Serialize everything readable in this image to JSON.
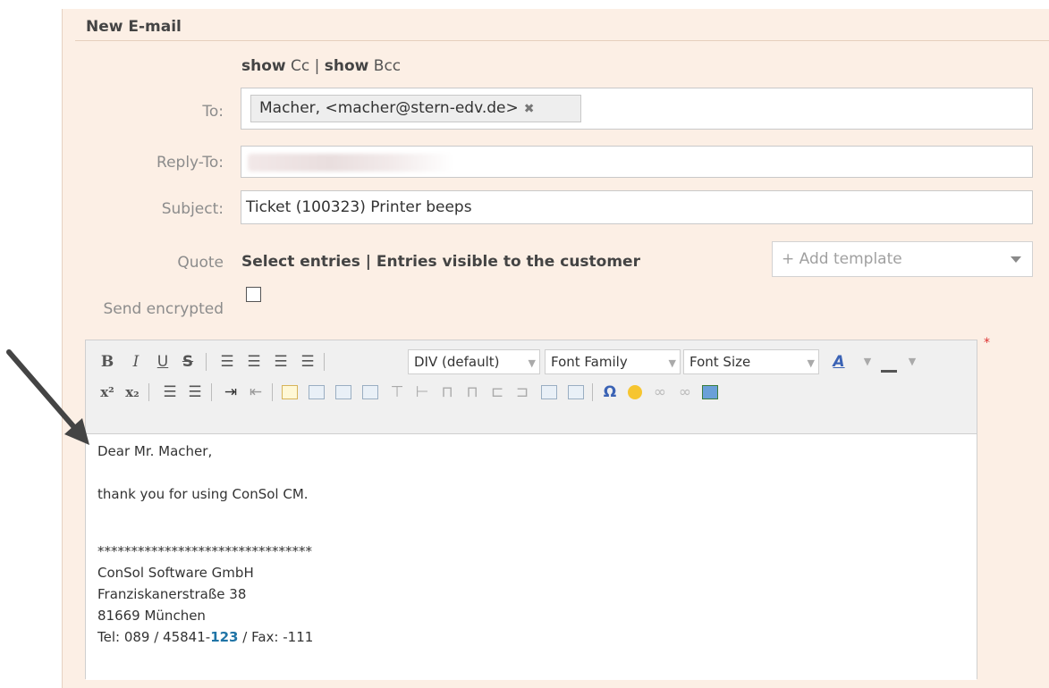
{
  "header": {
    "title": "New E-mail"
  },
  "cc_bcc": {
    "show1": "show",
    "cc": "Cc",
    "divider": "|",
    "show2": "show",
    "bcc": "Bcc"
  },
  "labels": {
    "to": "To:",
    "reply_to": "Reply-To:",
    "subject": "Subject:",
    "quote": "Quote",
    "send_encrypted": "Send encrypted"
  },
  "to": {
    "recipient_chip": "Macher, <macher@stern-edv.de>",
    "remove_icon": "✖"
  },
  "subject": {
    "value": "Ticket (100323) Printer beeps"
  },
  "quote": {
    "links": "Select entries | Entries visible to the customer"
  },
  "template": {
    "placeholder": "+ Add template"
  },
  "editor": {
    "paragraph_format": "DIV (default)",
    "font_family": "Font Family",
    "font_size": "Font Size",
    "body": {
      "line1": "Dear Mr. Macher,",
      "line2": "thank you for using ConSol CM.",
      "stars": "********************************",
      "company": "ConSol Software GmbH",
      "street": "Franziskanerstraße 38",
      "city": "81669 München",
      "tel_prefix": "Tel: 089 / 45841-",
      "tel_highlight": "123",
      "tel_suffix": " / Fax: -111"
    }
  },
  "icons": {
    "row1": [
      "bold-icon",
      "italic-icon",
      "underline-icon",
      "strikethrough-icon",
      "align-left-icon",
      "align-center-icon",
      "align-right-icon",
      "justify-icon",
      "text-color-icon",
      "background-color-icon"
    ],
    "row2": [
      "superscript-icon",
      "subscript-icon",
      "bullet-list-icon",
      "numbered-list-icon",
      "indent-icon",
      "outdent-icon",
      "edit-table-icon",
      "table-icons",
      "special-char-icon",
      "smiley-icon",
      "link-icon",
      "unlink-icon",
      "image-icon"
    ]
  },
  "colors": {
    "panel_bg": "#fcefe5",
    "highlight_link": "#1f74a6",
    "required": "#dd3333"
  }
}
